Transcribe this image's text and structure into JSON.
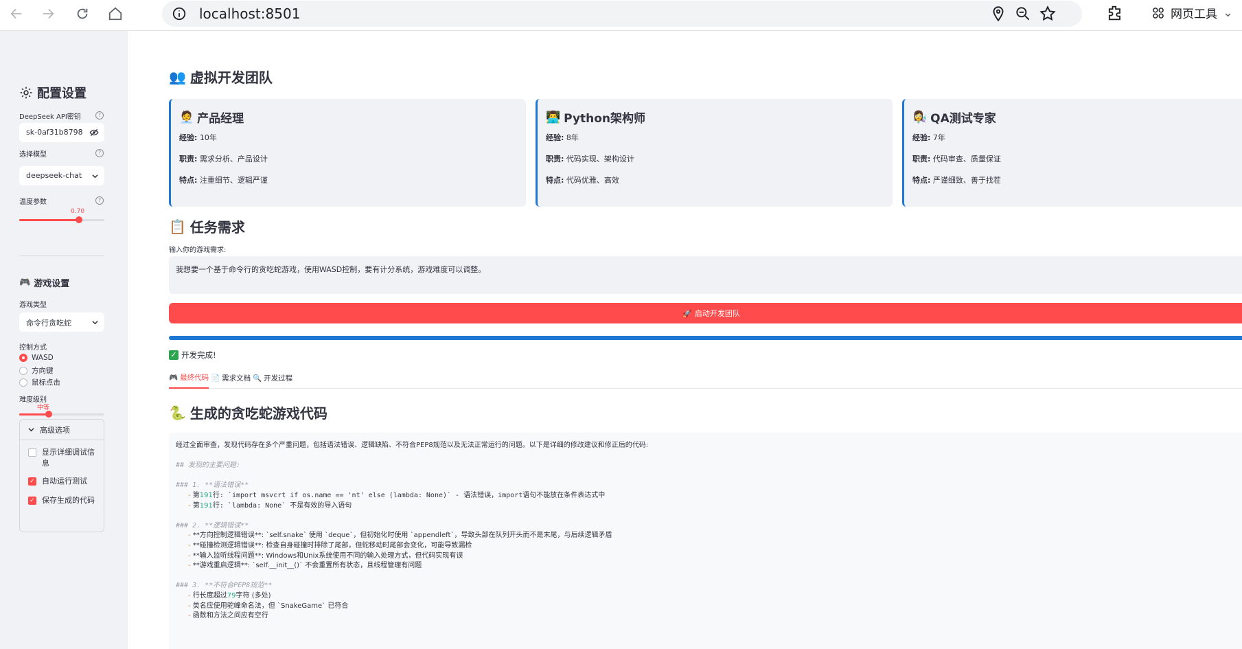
{
  "browser": {
    "url": "localhost:8501",
    "tools_label": "网页工具"
  },
  "sidebar": {
    "title": "配置设置",
    "api_key_label": "DeepSeek API密钥",
    "api_key_value": "sk-0af31b8798",
    "model_label": "选择模型",
    "model_value": "deepseek-chat",
    "temperature_label": "温度参数",
    "temperature_value": "0.70",
    "temperature_fraction": 0.7,
    "game_settings_title": "游戏设置",
    "game_type_label": "游戏类型",
    "game_type_value": "命令行贪吃蛇",
    "control_label": "控制方式",
    "control_options": [
      "WASD",
      "方向键",
      "鼠标点击"
    ],
    "control_selected": "WASD",
    "difficulty_label": "难度级别",
    "difficulty_value": "中等",
    "difficulty_fraction": 0.35,
    "advanced": {
      "title": "高级选项",
      "options": [
        {
          "label": "显示详细调试信息",
          "checked": false
        },
        {
          "label": "自动运行测试",
          "checked": true
        },
        {
          "label": "保存生成的代码",
          "checked": true
        }
      ]
    }
  },
  "main": {
    "team_title": "虚拟开发团队",
    "members": [
      {
        "name": "产品经理",
        "exp_label": "经验:",
        "exp": "10年",
        "duty_label": "职责:",
        "duty": "需求分析、产品设计",
        "trait_label": "特点:",
        "trait": "注重细节、逻辑严谨"
      },
      {
        "name": "Python架构师",
        "exp_label": "经验:",
        "exp": "8年",
        "duty_label": "职责:",
        "duty": "代码实现、架构设计",
        "trait_label": "特点:",
        "trait": "代码优雅、高效"
      },
      {
        "name": "QA测试专家",
        "exp_label": "经验:",
        "exp": "7年",
        "duty_label": "职责:",
        "duty": "代码审查、质量保证",
        "trait_label": "特点:",
        "trait": "严谨细致、善于找茬"
      }
    ],
    "task_title": "任务需求",
    "input_label": "输入你的游戏需求:",
    "input_value": "我想要一个基于命令行的贪吃蛇游戏，使用WASD控制，要有计分系统，游戏难度可以调整。",
    "start_button": "启动开发团队",
    "progress": 1.0,
    "success_text": "开发完成!",
    "tabs": [
      "最终代码",
      "需求文档",
      "开发过程"
    ],
    "active_tab": "最终代码",
    "code_title": "生成的贪吃蛇游戏代码",
    "code_intro": "经过全面审查，发现代码存在多个严重问题，包括语法错误、逻辑缺陷、不符合PEP8规范以及无法正常运行的问题。以下是详细的修改建议和修正后的代码:",
    "code_h_main": "## 发现的主要问题:",
    "sec1_title": "### 1. **语法错误**",
    "sec1_l1_a": "第",
    "sec1_l1_num": "191",
    "sec1_l1_b": "行: `import msvcrt if os.name == 'nt' else (lambda: None)` - 语法错误，import语句不能放在条件表达式中",
    "sec1_l2_a": "第",
    "sec1_l2_num": "191",
    "sec1_l2_b": "行: `lambda: None` 不是有效的导入语句",
    "sec2_title": "### 2. **逻辑错误**",
    "sec2_items": [
      "**方向控制逻辑错误**: `self.snake` 使用 `deque`，但初始化时使用 `appendleft`，导致头部在队列开头而不是末尾，与后续逻辑矛盾",
      "**碰撞检测逻辑错误**: 检查自身碰撞时排除了尾部，但蛇移动时尾部会变化，可能导致漏检",
      "**输入监听线程问题**: Windows和Unix系统使用不同的输入处理方式，但代码实现有误",
      "**游戏重启逻辑**: `self.__init__()` 不会重置所有状态，且线程管理有问题"
    ],
    "sec3_title": "### 3. **不符合PEP8规范**",
    "sec3_items": [
      {
        "a": "行长度超过",
        "num": "79",
        "b": "字符 (多处)"
      },
      {
        "a": "类名应使用驼峰命名法，但 `SnakeGame` 已符合",
        "num": "",
        "b": ""
      },
      {
        "a": "函数和方法之间应有空行",
        "num": "",
        "b": ""
      }
    ]
  },
  "colors": {
    "accent": "#ff4b4b",
    "primary_blue": "#1f77d4",
    "sidebar_bg": "#f0f2f6"
  }
}
